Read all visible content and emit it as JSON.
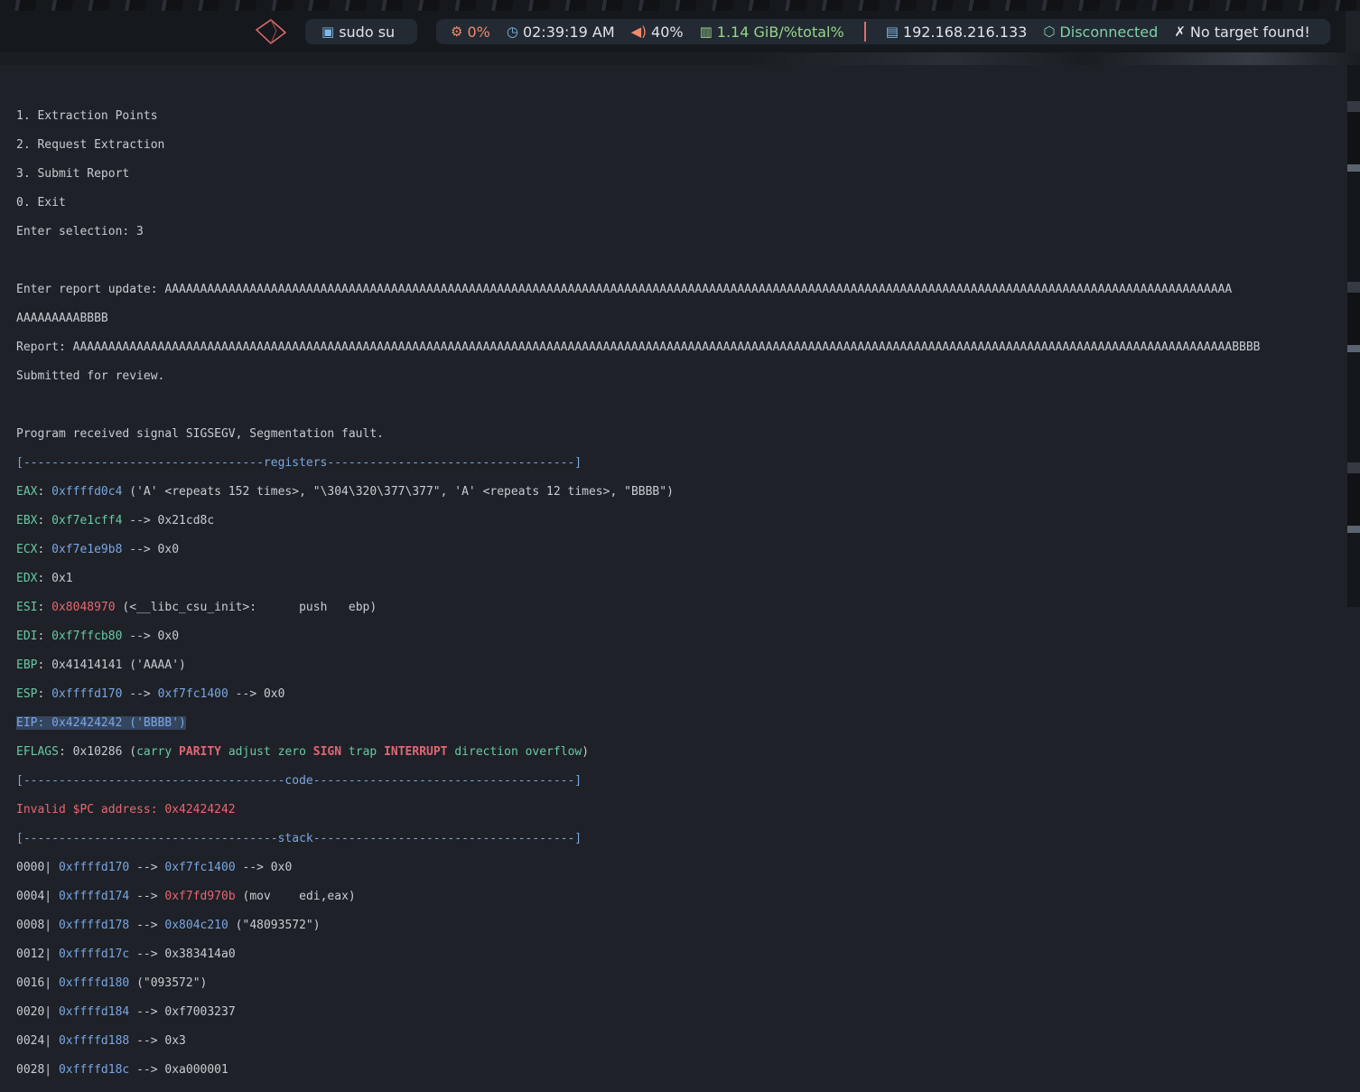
{
  "topbar": {
    "shell_label": "sudo su",
    "cpu": "0%",
    "clock": "02:39:19 AM",
    "volume": "40%",
    "memory": "1.14 GiB/%total%",
    "ip": "192.168.216.133",
    "vpn": "Disconnected",
    "target": "No target found!",
    "icons": [
      "logo-icon",
      "terminal-icon",
      "cpu-icon",
      "clock-icon",
      "volume-icon",
      "memory-icon",
      "network-icon",
      "vpn-icon",
      "target-icon"
    ],
    "colors": {
      "bar": "#15191e",
      "pill": "#232a33",
      "separator": "#e06c6c",
      "accent_red": "#ef8a6c",
      "accent_green": "#98d48a"
    }
  },
  "menu": {
    "items": [
      "1. Extraction Points",
      "2. Request Extraction",
      "3. Submit Report",
      "0. Exit"
    ],
    "prompt": "Enter selection: 3"
  },
  "report": {
    "prompt_label": "Enter report update: ",
    "input_line1": "AAAAAAAAAAAAAAAAAAAAAAAAAAAAAAAAAAAAAAAAAAAAAAAAAAAAAAAAAAAAAAAAAAAAAAAAAAAAAAAAAAAAAAAAAAAAAAAAAAAAAAAAAAAAAAAAAAAAAAAAAAAAAAAAAAAAAAAAAAAAAAAAAAAAAAA",
    "input_line2": "AAAAAAAAABBBB",
    "echo_label": "Report: ",
    "echo_value": "AAAAAAAAAAAAAAAAAAAAAAAAAAAAAAAAAAAAAAAAAAAAAAAAAAAAAAAAAAAAAAAAAAAAAAAAAAAAAAAAAAAAAAAAAAAAAAAAAAAAAAAAAAAAAAAAAAAAAAAAAAAAAAAAAAAAAAAAAAAAAAAAAAAAAAAAAAAAAAAAAAAABBBB",
    "submitted": "Submitted for review."
  },
  "signal": "Program received signal SIGSEGV, Segmentation fault.",
  "sections": {
    "registers": "[----------------------------------registers-----------------------------------]",
    "code": "[-------------------------------------code-------------------------------------]",
    "stack": "[------------------------------------stack-------------------------------------]"
  },
  "registers": {
    "eax": {
      "name": "EAX",
      "value": "0xffffd0c4",
      "rest": " ('A' <repeats 152 times>, \"\\304\\320\\377\\377\", 'A' <repeats 12 times>, \"BBBB\")"
    },
    "ebx": {
      "name": "EBX",
      "value": "0xf7e1cff4",
      "rest": " --> 0x21cd8c"
    },
    "ecx": {
      "name": "ECX",
      "value": "0xf7e1e9b8",
      "rest": " --> 0x0"
    },
    "edx": {
      "name": "EDX",
      "value": "0x1"
    },
    "esi": {
      "name": "ESI",
      "value": "0x8048970",
      "rest": " (<__libc_csu_init>:      push   ebp)"
    },
    "edi": {
      "name": "EDI",
      "value": "0xf7ffcb80",
      "rest": " --> 0x0"
    },
    "ebp": {
      "name": "EBP",
      "value": "0x41414141 ('AAAA')"
    },
    "esp": {
      "name": "ESP",
      "value": "0xffffd170",
      "arrow": " --> ",
      "value2": "0xf7fc1400",
      "rest": " --> 0x0"
    },
    "eip": {
      "name": "EIP",
      "value": "0x42424242 ('BBBB')"
    },
    "eflags": {
      "name": "EFLAGS",
      "value": "0x10286",
      "open": " (",
      "carry": "carry ",
      "parity": "PARITY",
      "adjust": " adjust ",
      "zero": "zero ",
      "sign": "SIGN",
      "trap": " trap ",
      "interrupt": "INTERRUPT",
      "direction": " direction ",
      "overflow": "overflow",
      "close": ")"
    }
  },
  "code": {
    "invalid_pc": "Invalid $PC address: 0x42424242"
  },
  "stack": [
    {
      "offset": "0000| ",
      "addr": "0xffffd170",
      "arrow": " --> ",
      "val": "0xf7fc1400",
      "rest": " --> 0x0"
    },
    {
      "offset": "0004| ",
      "addr": "0xffffd174",
      "arrow": " --> ",
      "val": "0xf7fd970b",
      "rest": " (mov    edi,eax)"
    },
    {
      "offset": "0008| ",
      "addr": "0xffffd178",
      "arrow": " --> ",
      "val": "0x804c210",
      "rest": " (\"48093572\")"
    },
    {
      "offset": "0012| ",
      "addr": "0xffffd17c",
      "rest": " --> 0x383414a0"
    },
    {
      "offset": "0016| ",
      "addr": "0xffffd180",
      "rest": " (\"093572\")"
    },
    {
      "offset": "0020| ",
      "addr": "0xffffd184",
      "rest": " --> 0xf7003237"
    },
    {
      "offset": "0024| ",
      "addr": "0xffffd188",
      "rest": " --> 0x3"
    },
    {
      "offset": "0028| ",
      "addr": "0xffffd18c",
      "rest": " --> 0xa000001"
    }
  ]
}
